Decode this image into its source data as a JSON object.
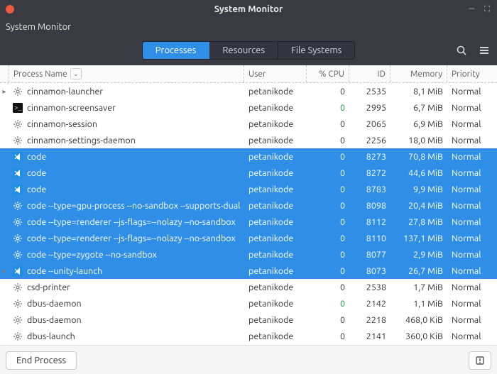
{
  "window": {
    "title": "System Monitor",
    "close_color": "#f05a3c"
  },
  "menubar": {
    "app_menu": "System Monitor"
  },
  "tabs": {
    "processes": "Processes",
    "resources": "Resources",
    "filesystems": "File Systems",
    "active_index": 0
  },
  "columns": {
    "name": "Process Name",
    "user": "User",
    "cpu": "% CPU",
    "id": "ID",
    "memory": "Memory",
    "priority": "Priority",
    "sort_column": "name",
    "sort_dir": "asc"
  },
  "footer": {
    "end_process": "End Process"
  },
  "processes": [
    {
      "icon": "gear",
      "name": "cinnamon-launcher",
      "user": "petanikode",
      "cpu": "0",
      "cpu_green": false,
      "id": "2535",
      "mem": "8,1 MiB",
      "priority": "Normal",
      "selected": false,
      "expandable": true
    },
    {
      "icon": "terminal",
      "name": "cinnamon-screensaver",
      "user": "petanikode",
      "cpu": "0",
      "cpu_green": true,
      "id": "2995",
      "mem": "6,7 MiB",
      "priority": "Normal",
      "selected": false,
      "expandable": false
    },
    {
      "icon": "gear",
      "name": "cinnamon-session",
      "user": "petanikode",
      "cpu": "0",
      "cpu_green": false,
      "id": "2065",
      "mem": "6,9 MiB",
      "priority": "Normal",
      "selected": false,
      "expandable": false
    },
    {
      "icon": "gear",
      "name": "cinnamon-settings-daemon",
      "user": "petanikode",
      "cpu": "0",
      "cpu_green": false,
      "id": "2256",
      "mem": "18,0 MiB",
      "priority": "Normal",
      "selected": false,
      "expandable": false
    },
    {
      "icon": "vscode",
      "name": "code",
      "user": "petanikode",
      "cpu": "0",
      "cpu_green": false,
      "id": "8273",
      "mem": "70,8 MiB",
      "priority": "Normal",
      "selected": true,
      "expandable": false
    },
    {
      "icon": "vscode",
      "name": "code",
      "user": "petanikode",
      "cpu": "0",
      "cpu_green": false,
      "id": "8272",
      "mem": "44,6 MiB",
      "priority": "Normal",
      "selected": true,
      "expandable": false
    },
    {
      "icon": "vscode",
      "name": "code",
      "user": "petanikode",
      "cpu": "0",
      "cpu_green": false,
      "id": "8783",
      "mem": "9,9 MiB",
      "priority": "Normal",
      "selected": true,
      "expandable": false
    },
    {
      "icon": "gear",
      "name": "code --type=gpu-process --no-sandbox --supports-dual",
      "user": "petanikode",
      "cpu": "0",
      "cpu_green": false,
      "id": "8098",
      "mem": "20,4 MiB",
      "priority": "Normal",
      "selected": true,
      "expandable": false
    },
    {
      "icon": "gear",
      "name": "code --type=renderer --js-flags=--nolazy --no-sandbox",
      "user": "petanikode",
      "cpu": "0",
      "cpu_green": false,
      "id": "8112",
      "mem": "27,8 MiB",
      "priority": "Normal",
      "selected": true,
      "expandable": false
    },
    {
      "icon": "gear",
      "name": "code --type=renderer --js-flags=--nolazy --no-sandbox",
      "user": "petanikode",
      "cpu": "0",
      "cpu_green": false,
      "id": "8110",
      "mem": "137,1 MiB",
      "priority": "Normal",
      "selected": true,
      "expandable": false
    },
    {
      "icon": "gear",
      "name": "code --type=zygote --no-sandbox",
      "user": "petanikode",
      "cpu": "0",
      "cpu_green": false,
      "id": "8077",
      "mem": "2,9 MiB",
      "priority": "Normal",
      "selected": true,
      "expandable": false
    },
    {
      "icon": "vscode",
      "name": "code --unity-launch",
      "user": "petanikode",
      "cpu": "0",
      "cpu_green": false,
      "id": "8073",
      "mem": "26,7 MiB",
      "priority": "Normal",
      "selected": true,
      "expandable": true
    },
    {
      "icon": "gear",
      "name": "csd-printer",
      "user": "petanikode",
      "cpu": "0",
      "cpu_green": false,
      "id": "2538",
      "mem": "1,7 MiB",
      "priority": "Normal",
      "selected": false,
      "expandable": false
    },
    {
      "icon": "gear",
      "name": "dbus-daemon",
      "user": "petanikode",
      "cpu": "0",
      "cpu_green": true,
      "id": "2142",
      "mem": "1,1 MiB",
      "priority": "Normal",
      "selected": false,
      "expandable": false
    },
    {
      "icon": "gear",
      "name": "dbus-daemon",
      "user": "petanikode",
      "cpu": "0",
      "cpu_green": false,
      "id": "2218",
      "mem": "468,0 KiB",
      "priority": "Normal",
      "selected": false,
      "expandable": false
    },
    {
      "icon": "gear",
      "name": "dbus-launch",
      "user": "petanikode",
      "cpu": "0",
      "cpu_green": false,
      "id": "2141",
      "mem": "360,0 KiB",
      "priority": "Normal",
      "selected": false,
      "expandable": false
    }
  ]
}
